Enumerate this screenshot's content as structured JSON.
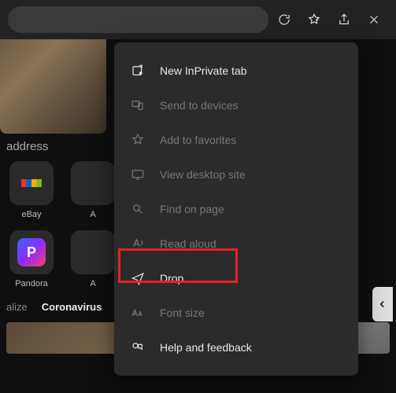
{
  "toolbar": {
    "placeholder": ""
  },
  "section_label": "address",
  "tiles": [
    {
      "label": "eBay"
    },
    {
      "label": "A"
    },
    {
      "label": "Pandora"
    },
    {
      "label": "A"
    }
  ],
  "tabs": {
    "left": "alize",
    "active": "Coronavirus"
  },
  "menu": {
    "new_inprivate": "New InPrivate tab",
    "send_devices": "Send to devices",
    "add_favorites": "Add to favorites",
    "view_desktop": "View desktop site",
    "find_page": "Find on page",
    "read_aloud": "Read aloud",
    "drop": "Drop",
    "font_size": "Font size",
    "help_feedback": "Help and feedback"
  },
  "highlight": "drop"
}
